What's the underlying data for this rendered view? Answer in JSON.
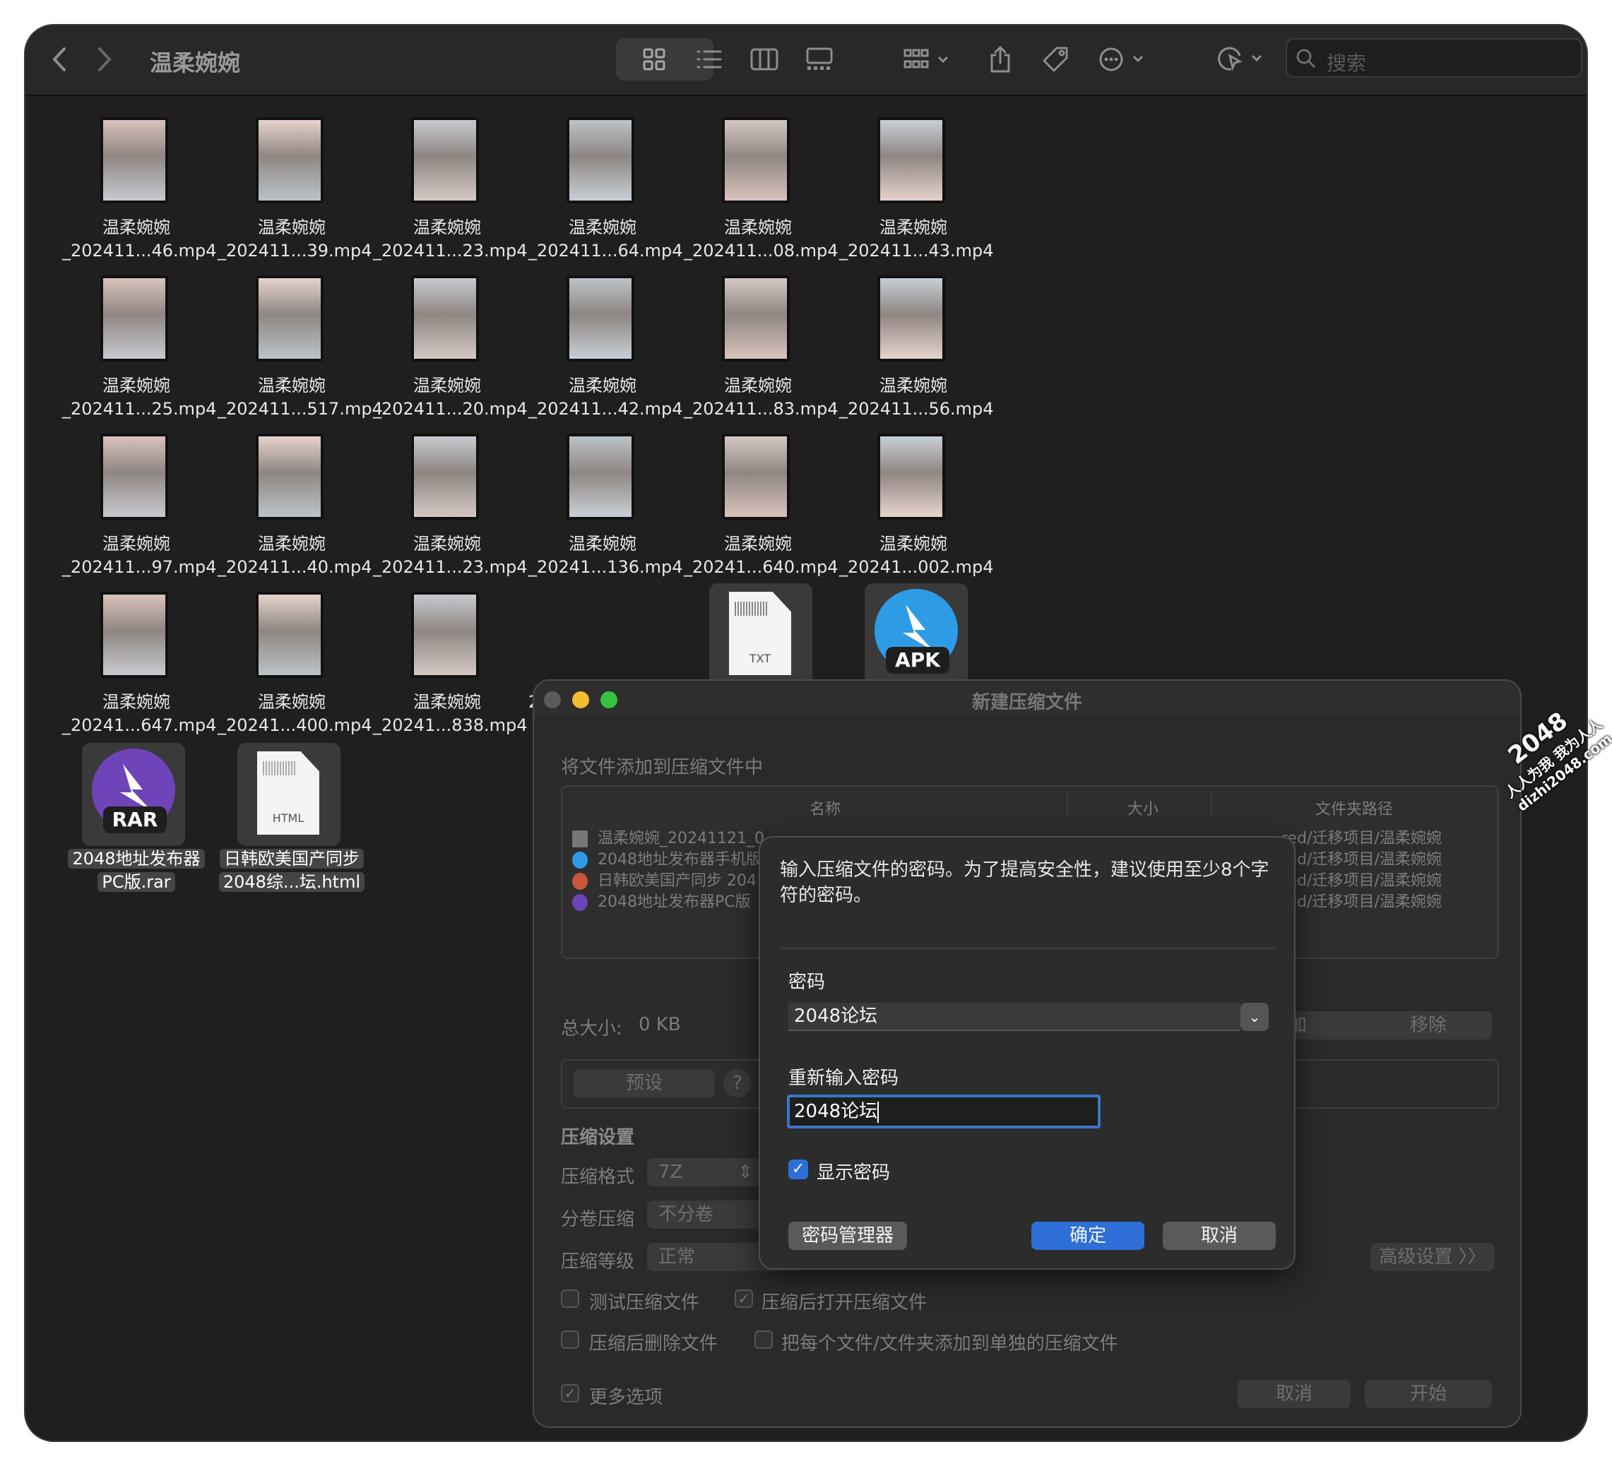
{
  "window": {
    "title": "温柔婉婉"
  },
  "toolbar": {
    "back_icon": "chevron-left-icon",
    "forward_icon": "chevron-right-icon",
    "search_placeholder": "搜索"
  },
  "files": [
    {
      "line1": "温柔婉婉",
      "line2": "_202411...46.mp4"
    },
    {
      "line1": "温柔婉婉",
      "line2": "_202411...39.mp4"
    },
    {
      "line1": "温柔婉婉",
      "line2": "_202411...23.mp4"
    },
    {
      "line1": "温柔婉婉",
      "line2": "_202411...64.mp4"
    },
    {
      "line1": "温柔婉婉",
      "line2": "_202411...08.mp4"
    },
    {
      "line1": "温柔婉婉",
      "line2": "_202411...43.mp4"
    },
    {
      "line1": "温柔婉婉",
      "line2": "_202411...25.mp4"
    },
    {
      "line1": "温柔婉婉",
      "line2": "_202411...517.mp4"
    },
    {
      "line1": "温柔婉婉",
      "line2": "_202411...20.mp4"
    },
    {
      "line1": "温柔婉婉",
      "line2": "_202411...42.mp4"
    },
    {
      "line1": "温柔婉婉",
      "line2": "_202411...83.mp4"
    },
    {
      "line1": "温柔婉婉",
      "line2": "_202411...56.mp4"
    },
    {
      "line1": "温柔婉婉",
      "line2": "_202411...97.mp4"
    },
    {
      "line1": "温柔婉婉",
      "line2": "_202411...40.mp4"
    },
    {
      "line1": "温柔婉婉",
      "line2": "_202411...23.mp4"
    },
    {
      "line1": "温柔婉婉",
      "line2": "_20241...136.mp4"
    },
    {
      "line1": "温柔婉婉",
      "line2": "_20241...640.mp4"
    },
    {
      "line1": "温柔婉婉",
      "line2": "_20241...002.mp4"
    },
    {
      "line1": "温柔婉婉",
      "line2": "_20241...647.mp4"
    },
    {
      "line1": "温柔婉婉",
      "line2": "_20241...400.mp4"
    },
    {
      "line1": "温柔婉婉",
      "line2": "_20241...838.mp4"
    },
    {
      "line1": "",
      "line2": "20"
    }
  ],
  "doc_icons": {
    "txt_label": "TXT",
    "apk_label": "APK",
    "rar_label": "RAR",
    "html_label": "HTML"
  },
  "selected_files": [
    {
      "line1": "2048地址发布器",
      "line2": "PC版.rar"
    },
    {
      "line1": "日韩欧美国产同步",
      "line2": "2048综...坛.html"
    }
  ],
  "archive": {
    "title": "新建压缩文件",
    "subtitle": "将文件添加到压缩文件中",
    "columns": [
      "名称",
      "大小",
      "文件夹路径"
    ],
    "rows": [
      {
        "name": "温柔婉婉_20241121_0",
        "path": "red/迁移项目/温柔婉婉"
      },
      {
        "name": "2048地址发布器手机版",
        "path": "red/迁移项目/温柔婉婉"
      },
      {
        "name": "日韩欧美国产同步 204",
        "path": "red/迁移项目/温柔婉婉"
      },
      {
        "name": "2048地址发布器PC版",
        "path": "red/迁移项目/温柔婉婉"
      }
    ],
    "total_label": "总大小:",
    "total_value": "0 KB",
    "add_partial": "加",
    "remove": "移除",
    "preset": "预设",
    "help": "?",
    "settings_heading": "压缩设置",
    "format_label": "压缩格式",
    "format_value": "7Z",
    "split_label": "分卷压缩",
    "split_value": "不分卷",
    "level_label": "压缩等级",
    "level_value": "正常",
    "advanced": "高级设置 〉〉",
    "test_archive": "测试压缩文件",
    "open_after": "压缩后打开压缩文件",
    "delete_after": "压缩后删除文件",
    "separate": "把每个文件/文件夹添加到单独的压缩文件",
    "more_options": "更多选项",
    "cancel": "取消",
    "start": "开始"
  },
  "password_dialog": {
    "message": "输入压缩文件的密码。为了提高安全性，建议使用至少8个字符的密码。",
    "password_label": "密码",
    "password_value": "2048论坛",
    "reenter_label": "重新输入密码",
    "reenter_value": "2048论坛",
    "show_password": "显示密码",
    "manager": "密码管理器",
    "ok": "确定",
    "cancel": "取消"
  },
  "watermark": {
    "line1": "2048",
    "line2": "人人为我 我为人人",
    "line3": "dizhi2048.com"
  },
  "colors": {
    "accent": "#2d6fd6",
    "window_bg": "#1f1f1f"
  }
}
